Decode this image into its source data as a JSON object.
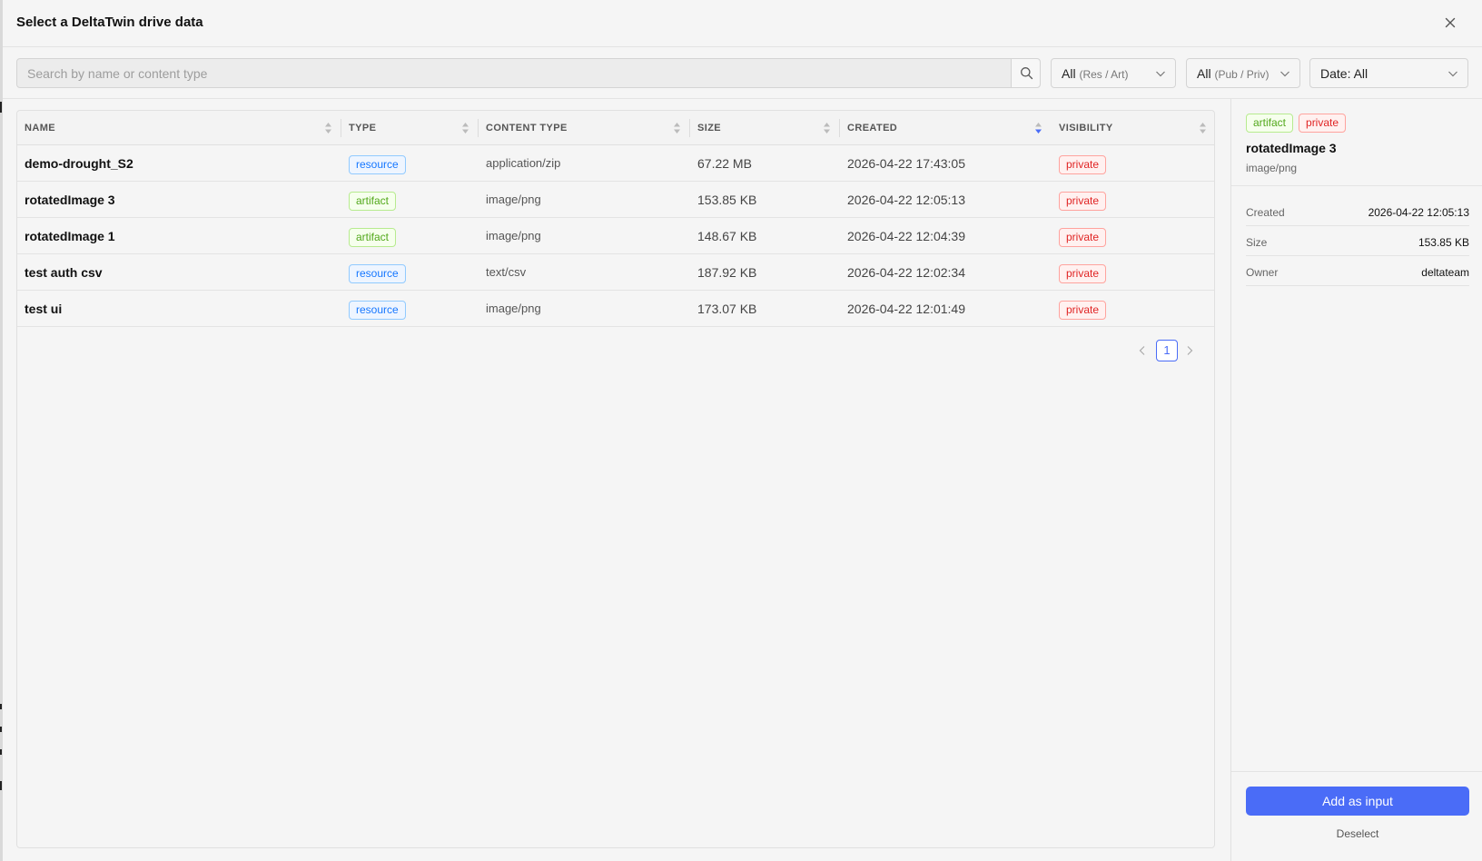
{
  "dialog": {
    "title": "Select a DeltaTwin drive data"
  },
  "toolbar": {
    "search_placeholder": "Search by name or content type",
    "filter_kind": {
      "main": "All",
      "sub": "(Res / Art)"
    },
    "filter_visibility": {
      "main": "All",
      "sub": "(Pub / Priv)"
    },
    "filter_date": {
      "main": "Date: All"
    }
  },
  "table": {
    "columns": [
      "NAME",
      "TYPE",
      "CONTENT TYPE",
      "SIZE",
      "CREATED",
      "VISIBILITY"
    ],
    "sorted_column": "CREATED",
    "sort_direction": "descending",
    "rows": [
      {
        "name": "demo-drought_S2",
        "type": "resource",
        "content_type": "application/zip",
        "size": "67.22 MB",
        "created": "2026-04-22 17:43:05",
        "visibility": "private"
      },
      {
        "name": "rotatedImage 3",
        "type": "artifact",
        "content_type": "image/png",
        "size": "153.85 KB",
        "created": "2026-04-22 12:05:13",
        "visibility": "private"
      },
      {
        "name": "rotatedImage 1",
        "type": "artifact",
        "content_type": "image/png",
        "size": "148.67 KB",
        "created": "2026-04-22 12:04:39",
        "visibility": "private"
      },
      {
        "name": "test auth csv",
        "type": "resource",
        "content_type": "text/csv",
        "size": "187.92 KB",
        "created": "2026-04-22 12:02:34",
        "visibility": "private"
      },
      {
        "name": "test ui",
        "type": "resource",
        "content_type": "image/png",
        "size": "173.07 KB",
        "created": "2026-04-22 12:01:49",
        "visibility": "private"
      }
    ]
  },
  "pagination": {
    "current_page": "1"
  },
  "detail": {
    "type_tag": "artifact",
    "visibility_tag": "private",
    "name": "rotatedImage 3",
    "content_type": "image/png",
    "meta": [
      {
        "key": "Created",
        "value": "2026-04-22 12:05:13"
      },
      {
        "key": "Size",
        "value": "153.85 KB"
      },
      {
        "key": "Owner",
        "value": "deltateam"
      }
    ],
    "add_button": "Add as input",
    "deselect_link": "Deselect"
  },
  "colors": {
    "accent": "#4a6cf7",
    "resource_tag": "#1677ff",
    "artifact_tag": "#52a81a",
    "private_tag": "#e02424"
  },
  "icons": {
    "close": "close-icon",
    "search": "search-icon",
    "dropdown": "chevron-down-icon",
    "sort": "sort-icon",
    "prev": "chevron-left-icon",
    "next": "chevron-right-icon"
  }
}
